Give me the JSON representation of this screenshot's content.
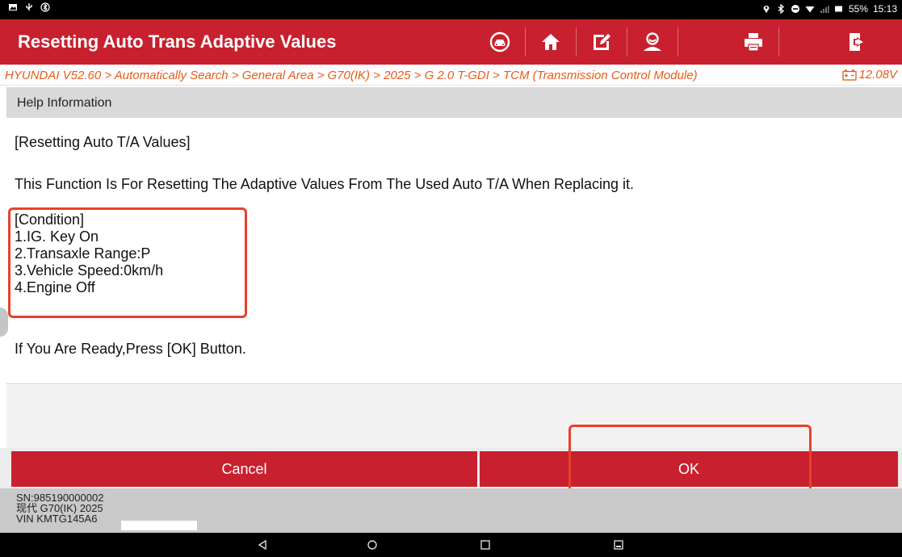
{
  "status_bar": {
    "battery": "55%",
    "time": "15:13"
  },
  "header": {
    "title": "Resetting Auto Trans Adaptive Values",
    "tools": [
      {
        "name": "car-diagnostic-icon"
      },
      {
        "name": "home-icon"
      },
      {
        "name": "edit-icon"
      },
      {
        "name": "user-icon"
      },
      {
        "name": "print-icon"
      },
      {
        "name": "exit-icon"
      }
    ]
  },
  "breadcrumb": {
    "path": "HYUNDAI V52.60 > Automatically Search > General Area > G70(IK) > 2025 > G 2.0 T-GDI > TCM (Transmission Control Module)",
    "voltage": "12.08V"
  },
  "help": {
    "header": "Help Information",
    "heading": "[Resetting Auto T/A Values]",
    "description": "This Function Is For Resetting The Adaptive Values From The Used Auto T/A When Replacing it.",
    "conditions": [
      "[Condition]",
      "1.IG. Key On",
      "2.Transaxle Range:P",
      "3.Vehicle Speed:0km/h",
      "4.Engine Off"
    ],
    "prompt": "If You Are Ready,Press [OK] Button."
  },
  "buttons": {
    "cancel": "Cancel",
    "ok": "OK"
  },
  "device": {
    "sn": "SN:985190000002",
    "model": "现代 G70(IK) 2025",
    "vin": "VIN KMTG145A6"
  },
  "colors": {
    "brand_red": "#c8202e",
    "breadcrumb_orange": "#e85a1a",
    "highlight_box": "#e8412a"
  }
}
